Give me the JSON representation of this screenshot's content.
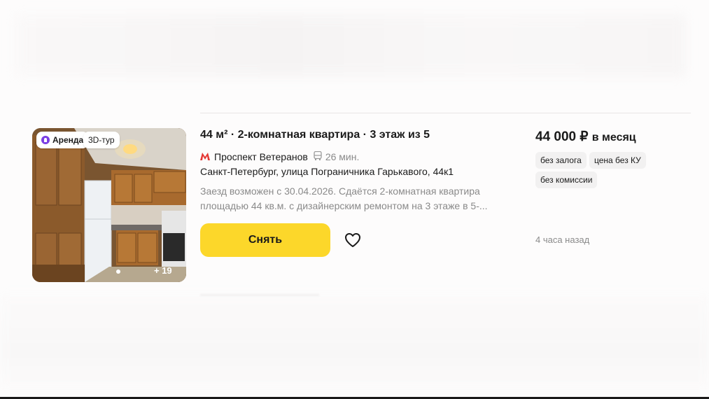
{
  "listing": {
    "badges": {
      "rent": "Аренда",
      "tour": "3D-тур"
    },
    "photo_more": "+ 19",
    "title": "44 м² · 2-комнатная квартира · 3 этаж из 5",
    "metro": {
      "icon": "metro-icon",
      "station": "Проспект Ветеранов",
      "transport_icon": "bus-icon",
      "time": "26 мин."
    },
    "address": "Санкт-Петербург, улица Пограничника Гарькавого, 44к1",
    "description": "Заезд возможен с 30.04.2026. Сдаётся 2-комнатная квартира площадью 44 кв.м. с дизайнерским ремонтом на 3 этаже в 5-...",
    "rent_button": "Снять",
    "favorite_icon": "heart-icon",
    "price": {
      "amount": "44 000 ₽",
      "period": "в месяц"
    },
    "tags": [
      "без залога",
      "цена без КУ",
      "без комиссии"
    ],
    "posted": "4 часа назад"
  },
  "colors": {
    "accent": "#fcd72a",
    "metro": "#e53935",
    "rent_badge": "#7b3fe4"
  }
}
